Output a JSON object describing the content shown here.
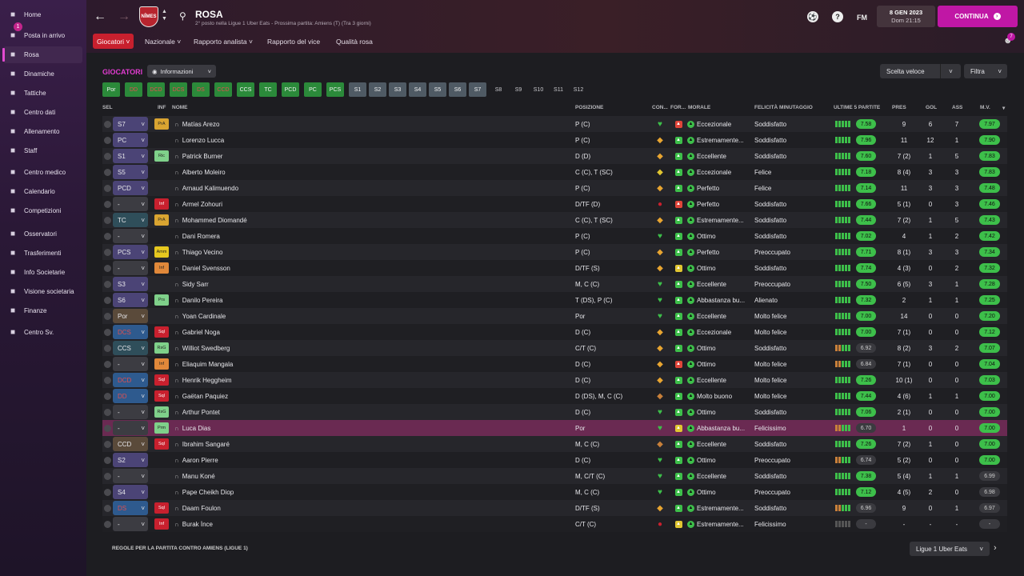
{
  "sidebar": {
    "items": [
      {
        "label": "Home",
        "icon": "home-icon"
      },
      {
        "label": "Posta in arrivo",
        "icon": "inbox-icon",
        "badge": "1"
      },
      {
        "label": "Rosa",
        "icon": "shirt-icon",
        "active": true
      },
      {
        "label": "Dinamiche",
        "icon": "dynamics-icon"
      },
      {
        "label": "Tattiche",
        "icon": "tactics-icon"
      },
      {
        "label": "Centro dati",
        "icon": "data-icon"
      },
      {
        "label": "Allenamento",
        "icon": "training-icon"
      },
      {
        "label": "Staff",
        "icon": "staff-icon"
      },
      {
        "label": "Centro medico",
        "icon": "medical-icon"
      },
      {
        "label": "Calendario",
        "icon": "calendar-icon"
      },
      {
        "label": "Competizioni",
        "icon": "trophy-icon"
      },
      {
        "label": "Osservatori",
        "icon": "scout-icon"
      },
      {
        "label": "Trasferimenti",
        "icon": "transfer-icon"
      },
      {
        "label": "Info Societarie",
        "icon": "club-info-icon"
      },
      {
        "label": "Visione societaria",
        "icon": "vision-icon"
      },
      {
        "label": "Finanze",
        "icon": "finance-icon"
      },
      {
        "label": "Centro Sv.",
        "icon": "development-icon"
      }
    ]
  },
  "header": {
    "crest_text": "NÎMES",
    "title": "ROSA",
    "subtitle": "2° posto nella Ligue 1 Uber Eats - Prossima partita: Amiens (T) (Tra 3 giorni)",
    "fm_label": "FM",
    "date": "8 GEN 2023",
    "time": "Dom 21:15",
    "continue_label": "CONTINUA",
    "notif_count": "7"
  },
  "tabs": [
    "Giocatori",
    "Nazionale",
    "Rapporto analista",
    "Rapporto del vice",
    "Qualità rosa"
  ],
  "toolbar": {
    "section_title": "GIOCATORI",
    "view_select": "Informazioni",
    "quick_select": "Scelta veloce",
    "filter": "Filtra"
  },
  "chips": [
    "Por",
    "DD",
    "DCD",
    "DCS",
    "DS",
    "CCD",
    "CCS",
    "TC",
    "PCD",
    "PC",
    "PCS",
    "S1",
    "S2",
    "S3",
    "S4",
    "S5",
    "S6",
    "S7",
    "S8",
    "S9",
    "S10",
    "S11",
    "S12"
  ],
  "columns": {
    "sel": "SEL",
    "inf": "INF",
    "name": "NOME",
    "pos": "POSIZIONE",
    "con": "CON...",
    "form": "FOR...",
    "morale": "MORALE",
    "happy": "FELICITÀ MINUTAGGIO",
    "last5": "ULTIME 5 PARTITE",
    "pres": "PRES",
    "gol": "GOL",
    "ass": "ASS",
    "mv": "M.V."
  },
  "players": [
    {
      "role": "S7",
      "rc": "purple",
      "inf": "PrA",
      "ic": "#d9a431",
      "name": "Matías Arezo",
      "pos": "P (C)",
      "con": "♥",
      "cc": "#3dbf4a",
      "fc": "#e0453a",
      "morale": "Eccezionale",
      "happy": "Soddisfatto",
      "last5": "7.58",
      "pres": "9",
      "gol": "6",
      "ass": "7",
      "mv": "7.97"
    },
    {
      "role": "PC",
      "rc": "purple",
      "inf": "",
      "ic": "",
      "name": "Lorenzo Lucca",
      "pos": "P (C)",
      "con": "◆",
      "cc": "#e8a531",
      "fc": "#3dbf4a",
      "morale": "Estremamente...",
      "happy": "Soddisfatto",
      "last5": "7.96",
      "pres": "11",
      "gol": "12",
      "ass": "1",
      "mv": "7.90"
    },
    {
      "role": "S1",
      "rc": "purple",
      "inf": "Ric",
      "ic": "#7fd08a",
      "name": "Patrick Burner",
      "pos": "D (D)",
      "con": "◆",
      "cc": "#e8a531",
      "fc": "#3dbf4a",
      "morale": "Eccellente",
      "happy": "Soddisfatto",
      "last5": "7.60",
      "pres": "7 (2)",
      "gol": "1",
      "ass": "5",
      "mv": "7.83"
    },
    {
      "role": "S5",
      "rc": "purple",
      "inf": "",
      "ic": "",
      "name": "Alberto Moleiro",
      "pos": "C (C), T (SC)",
      "con": "◆",
      "cc": "#e0c531",
      "fc": "#3dbf4a",
      "morale": "Eccezionale",
      "happy": "Felice",
      "last5": "7.18",
      "pres": "8 (4)",
      "gol": "3",
      "ass": "3",
      "mv": "7.83"
    },
    {
      "role": "PCD",
      "rc": "purple",
      "inf": "",
      "ic": "",
      "name": "Arnaud Kalimuendo",
      "pos": "P (C)",
      "con": "◆",
      "cc": "#e8a531",
      "fc": "#3dbf4a",
      "morale": "Perfetto",
      "happy": "Felice",
      "last5": "7.14",
      "pres": "11",
      "gol": "3",
      "ass": "3",
      "mv": "7.48"
    },
    {
      "role": "-",
      "rc": "",
      "inf": "Inf",
      "ic": "#c8202e",
      "name": "Armel Zohouri",
      "pos": "D/TF (D)",
      "con": "●",
      "cc": "#c8202e",
      "fc": "#e0453a",
      "morale": "Perfetto",
      "happy": "Soddisfatto",
      "last5": "7.66",
      "pres": "5 (1)",
      "gol": "0",
      "ass": "3",
      "mv": "7.46"
    },
    {
      "role": "TC",
      "rc": "teal",
      "inf": "PrA",
      "ic": "#d9a431",
      "name": "Mohammed Diomandé",
      "pos": "C (C), T (SC)",
      "con": "◆",
      "cc": "#e8a531",
      "fc": "#3dbf4a",
      "morale": "Estremamente...",
      "happy": "Soddisfatto",
      "last5": "7.44",
      "pres": "7 (2)",
      "gol": "1",
      "ass": "5",
      "mv": "7.43"
    },
    {
      "role": "-",
      "rc": "",
      "inf": "",
      "ic": "",
      "name": "Dani Romera",
      "pos": "P (C)",
      "con": "♥",
      "cc": "#3dbf4a",
      "fc": "#3dbf4a",
      "morale": "Ottimo",
      "happy": "Soddisfatto",
      "last5": "7.02",
      "pres": "4",
      "gol": "1",
      "ass": "2",
      "mv": "7.42"
    },
    {
      "role": "PCS",
      "rc": "purple",
      "inf": "Amm",
      "ic": "#e6c81f",
      "name": "Thiago Vecino",
      "pos": "P (C)",
      "con": "◆",
      "cc": "#e8a531",
      "fc": "#3dbf4a",
      "morale": "Perfetto",
      "happy": "Preoccupato",
      "last5": "7.71",
      "pres": "8 (1)",
      "gol": "3",
      "ass": "3",
      "mv": "7.34"
    },
    {
      "role": "-",
      "rc": "",
      "inf": "Inf",
      "ic": "#e0883a",
      "name": "Daniel Svensson",
      "pos": "D/TF (S)",
      "con": "◆",
      "cc": "#e8a531",
      "fc": "#e0c531",
      "morale": "Ottimo",
      "happy": "Soddisfatto",
      "last5": "7.74",
      "pres": "4 (3)",
      "gol": "0",
      "ass": "2",
      "mv": "7.32"
    },
    {
      "role": "S3",
      "rc": "purple",
      "inf": "",
      "ic": "",
      "name": "Sidy Sarr",
      "pos": "M, C (C)",
      "con": "♥",
      "cc": "#3dbf4a",
      "fc": "#3dbf4a",
      "morale": "Eccellente",
      "happy": "Preoccupato",
      "last5": "7.50",
      "pres": "6 (5)",
      "gol": "3",
      "ass": "1",
      "mv": "7.28"
    },
    {
      "role": "S6",
      "rc": "purple",
      "inf": "Prs",
      "ic": "#7fd08a",
      "name": "Danilo Pereira",
      "pos": "T (DS), P (C)",
      "con": "♥",
      "cc": "#3dbf4a",
      "fc": "#3dbf4a",
      "morale": "Abbastanza bu...",
      "happy": "Alienato",
      "last5": "7.32",
      "pres": "2",
      "gol": "1",
      "ass": "1",
      "mv": "7.25"
    },
    {
      "role": "Por",
      "rc": "tan",
      "inf": "",
      "ic": "",
      "name": "Yoan Cardinale",
      "pos": "Por",
      "con": "♥",
      "cc": "#3dbf4a",
      "fc": "#3dbf4a",
      "morale": "Eccellente",
      "happy": "Molto felice",
      "last5": "7.00",
      "pres": "14",
      "gol": "0",
      "ass": "0",
      "mv": "7.20"
    },
    {
      "role": "DCS",
      "rc": "blue",
      "inf": "Sql",
      "ic": "#c8202e",
      "name": "Gabriel Noga",
      "pos": "D (C)",
      "con": "◆",
      "cc": "#e8a531",
      "fc": "#3dbf4a",
      "morale": "Eccezionale",
      "happy": "Molto felice",
      "last5": "7.00",
      "pres": "7 (1)",
      "gol": "0",
      "ass": "0",
      "mv": "7.12"
    },
    {
      "role": "CCS",
      "rc": "teal",
      "inf": "RsG",
      "ic": "#7fd08a",
      "name": "Williot Swedberg",
      "pos": "C/T (C)",
      "con": "◆",
      "cc": "#e8a531",
      "fc": "#3dbf4a",
      "morale": "Ottimo",
      "happy": "Soddisfatto",
      "last5": "6.92",
      "pres": "8 (2)",
      "gol": "3",
      "ass": "2",
      "mv": "7.07"
    },
    {
      "role": "-",
      "rc": "",
      "inf": "Inf",
      "ic": "#e0883a",
      "name": "Eliaquim Mangala",
      "pos": "D (C)",
      "con": "◆",
      "cc": "#e8a531",
      "fc": "#e0453a",
      "morale": "Ottimo",
      "happy": "Molto felice",
      "last5": "6.84",
      "pres": "7 (1)",
      "gol": "0",
      "ass": "0",
      "mv": "7.04"
    },
    {
      "role": "DCD",
      "rc": "blue",
      "inf": "Sql",
      "ic": "#c8202e",
      "name": "Henrik Heggheim",
      "pos": "D (C)",
      "con": "◆",
      "cc": "#e8a531",
      "fc": "#3dbf4a",
      "morale": "Eccellente",
      "happy": "Molto felice",
      "last5": "7.26",
      "pres": "10 (1)",
      "gol": "0",
      "ass": "0",
      "mv": "7.03"
    },
    {
      "role": "DD",
      "rc": "blue",
      "inf": "Sql",
      "ic": "#c8202e",
      "name": "Gaëtan Paquiez",
      "pos": "D (DS), M, C (C)",
      "con": "◆",
      "cc": "#c8803a",
      "fc": "#3dbf4a",
      "morale": "Molto buono",
      "happy": "Molto felice",
      "last5": "7.44",
      "pres": "4 (6)",
      "gol": "1",
      "ass": "1",
      "mv": "7.00"
    },
    {
      "role": "-",
      "rc": "",
      "inf": "RsG",
      "ic": "#7fd08a",
      "name": "Arthur Pontet",
      "pos": "D (C)",
      "con": "♥",
      "cc": "#3dbf4a",
      "fc": "#3dbf4a",
      "morale": "Ottimo",
      "happy": "Soddisfatto",
      "last5": "7.06",
      "pres": "2 (1)",
      "gol": "0",
      "ass": "0",
      "mv": "7.00"
    },
    {
      "role": "-",
      "rc": "",
      "inf": "Prm",
      "ic": "#7fd08a",
      "name": "Luca Dias",
      "pos": "Por",
      "con": "♥",
      "cc": "#3dbf4a",
      "fc": "#e0c531",
      "morale": "Abbastanza bu...",
      "happy": "Felicissimo",
      "last5": "6.70",
      "pres": "1",
      "gol": "0",
      "ass": "0",
      "mv": "7.00",
      "hl": true
    },
    {
      "role": "CCD",
      "rc": "tan",
      "inf": "Sql",
      "ic": "#c8202e",
      "name": "Ibrahim Sangaré",
      "pos": "M, C (C)",
      "con": "◆",
      "cc": "#c8803a",
      "fc": "#3dbf4a",
      "morale": "Eccellente",
      "happy": "Soddisfatto",
      "last5": "7.26",
      "pres": "7 (2)",
      "gol": "1",
      "ass": "0",
      "mv": "7.00"
    },
    {
      "role": "S2",
      "rc": "purple",
      "inf": "",
      "ic": "",
      "name": "Aaron Pierre",
      "pos": "D (C)",
      "con": "♥",
      "cc": "#3dbf4a",
      "fc": "#3dbf4a",
      "morale": "Ottimo",
      "happy": "Preoccupato",
      "last5": "6.74",
      "pres": "5 (2)",
      "gol": "0",
      "ass": "0",
      "mv": "7.00"
    },
    {
      "role": "-",
      "rc": "",
      "inf": "",
      "ic": "",
      "name": "Manu Koné",
      "pos": "M, C/T (C)",
      "con": "♥",
      "cc": "#3dbf4a",
      "fc": "#3dbf4a",
      "morale": "Eccellente",
      "happy": "Soddisfatto",
      "last5": "7.38",
      "pres": "5 (4)",
      "gol": "1",
      "ass": "1",
      "mv": "6.99"
    },
    {
      "role": "S4",
      "rc": "purple",
      "inf": "",
      "ic": "",
      "name": "Pape Cheikh Diop",
      "pos": "M, C (C)",
      "con": "♥",
      "cc": "#3dbf4a",
      "fc": "#3dbf4a",
      "morale": "Ottimo",
      "happy": "Preoccupato",
      "last5": "7.12",
      "pres": "4 (5)",
      "gol": "2",
      "ass": "0",
      "mv": "6.98"
    },
    {
      "role": "DS",
      "rc": "blue",
      "inf": "Sql",
      "ic": "#c8202e",
      "name": "Daam Foulon",
      "pos": "D/TF (S)",
      "con": "◆",
      "cc": "#e8a531",
      "fc": "#3dbf4a",
      "morale": "Estremamente...",
      "happy": "Soddisfatto",
      "last5": "6.96",
      "pres": "9",
      "gol": "0",
      "ass": "1",
      "mv": "6.97"
    },
    {
      "role": "-",
      "rc": "",
      "inf": "Inf",
      "ic": "#c8202e",
      "name": "Burak İnce",
      "pos": "C/T (C)",
      "con": "●",
      "cc": "#c8202e",
      "fc": "#e0c531",
      "morale": "Estremamente...",
      "happy": "Felicissimo",
      "last5": "-",
      "pres": "-",
      "gol": "-",
      "ass": "-",
      "mv": "-"
    }
  ],
  "footer": {
    "rules": "REGOLE PER LA PARTITA CONTRO AMIENS (LIGUE 1)",
    "competition": "Ligue 1 Uber Eats"
  },
  "colors": {
    "accent": "#c017a5",
    "positive": "#3dbf4a",
    "negative": "#c8202e"
  }
}
